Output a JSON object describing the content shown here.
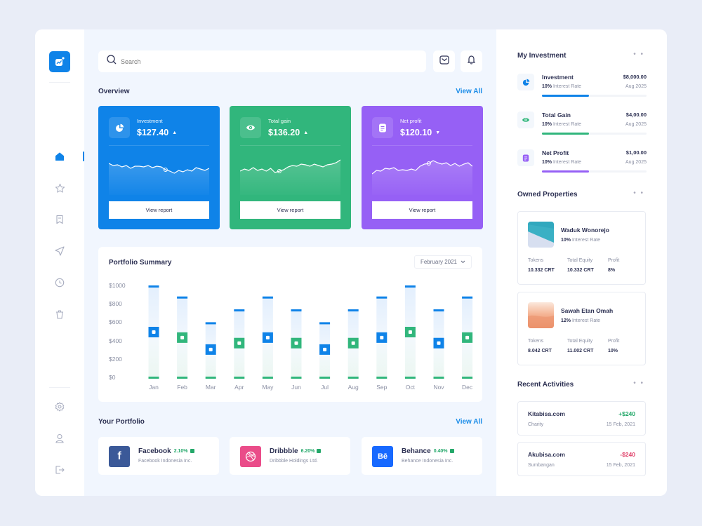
{
  "colors": {
    "brand": "#0f83e8",
    "green": "#31b67c",
    "purple": "#9660f5",
    "positive": "#24a86a",
    "negative": "#e0436b"
  },
  "sidebar": {
    "logo_icon": "chart-logo-icon",
    "nav": [
      {
        "icon": "home-icon",
        "active": true
      },
      {
        "icon": "star-icon",
        "active": false
      },
      {
        "icon": "bookmark-icon",
        "active": false
      },
      {
        "icon": "send-icon",
        "active": false
      },
      {
        "icon": "clock-icon",
        "active": false
      },
      {
        "icon": "trash-icon",
        "active": false
      }
    ],
    "bottom": [
      {
        "icon": "settings-icon"
      },
      {
        "icon": "user-icon"
      },
      {
        "icon": "logout-icon"
      }
    ]
  },
  "header": {
    "search_placeholder": "Search",
    "mail_icon": "mail-icon",
    "bell_icon": "bell-icon"
  },
  "overview": {
    "title": "Overview",
    "view_all": "View All",
    "cards": [
      {
        "label": "Investment",
        "value": "$127.40",
        "trend": "up",
        "trend_glyph": "▲",
        "button": "View report",
        "icon": "pie-chart-icon",
        "spark": [
          20,
          23,
          22,
          25,
          23,
          27,
          24,
          24,
          25,
          23,
          26,
          24,
          25,
          29,
          31,
          34,
          30,
          32,
          29,
          31,
          26,
          28,
          30,
          27
        ]
      },
      {
        "label": "Total gain",
        "value": "$136.20",
        "trend": "up",
        "trend_glyph": "▲",
        "button": "View report",
        "icon": "eye-icon",
        "spark": [
          31,
          28,
          30,
          26,
          30,
          28,
          31,
          27,
          33,
          31,
          29,
          25,
          23,
          24,
          21,
          22,
          24,
          21,
          23,
          25,
          22,
          21,
          19,
          15
        ]
      },
      {
        "label": "Net profit",
        "value": "$120.10",
        "trend": "down",
        "trend_glyph": "▼",
        "button": "View report",
        "icon": "document-icon",
        "spark": [
          35,
          30,
          31,
          27,
          28,
          26,
          30,
          29,
          30,
          28,
          30,
          24,
          21,
          20,
          16,
          19,
          21,
          19,
          23,
          20,
          24,
          21,
          19,
          24
        ]
      }
    ]
  },
  "portfolio_summary": {
    "title": "Portfolio Summary",
    "period": "February 2021",
    "chart_data": {
      "type": "bar",
      "title": "Portfolio Summary",
      "categories": [
        "Jan",
        "Feb",
        "Mar",
        "Apr",
        "May",
        "Jun",
        "Jul",
        "Aug",
        "Sep",
        "Oct",
        "Nov",
        "Dec"
      ],
      "series": [
        {
          "name": "High",
          "values": [
            1000,
            880,
            600,
            740,
            880,
            740,
            600,
            740,
            880,
            1000,
            740,
            880
          ]
        },
        {
          "name": "Marker",
          "values": [
            500,
            440,
            310,
            380,
            440,
            380,
            310,
            380,
            440,
            500,
            380,
            440
          ]
        }
      ],
      "marker_colors": [
        "blue",
        "green",
        "blue",
        "green",
        "blue",
        "green",
        "blue",
        "green",
        "blue",
        "green",
        "blue",
        "green"
      ],
      "yticks": [
        "$0",
        "$200",
        "$400",
        "$600",
        "$800",
        "$1000"
      ],
      "ylim": [
        0,
        1000
      ],
      "grid": false
    }
  },
  "your_portfolio": {
    "title": "Your Portfolio",
    "view_all": "View All",
    "items": [
      {
        "name": "Facebook",
        "pct": "2.10%",
        "company": "Facebook Indonesia Inc.",
        "logo": "f",
        "icon": "facebook-icon",
        "color": "#3b5998"
      },
      {
        "name": "Dribbble",
        "pct": "6.20%",
        "company": "Dribbble Holdings Ltd.",
        "logo": "",
        "icon": "dribbble-icon",
        "color": "#ea4c89"
      },
      {
        "name": "Behance",
        "pct": "0.40%",
        "company": "Behance Indonesia Inc.",
        "logo": "Bē",
        "icon": "behance-icon",
        "color": "#1769ff"
      }
    ]
  },
  "my_investment": {
    "title": "My Investment",
    "more": "• •",
    "items": [
      {
        "name": "Investment",
        "rate": "10%",
        "rate_label": "Interest Rate",
        "amount": "$8,000.00",
        "date": "Aug 2025",
        "progress": 0.45,
        "color": "#0f83e8",
        "icon": "pie-chart-icon"
      },
      {
        "name": "Total Gain",
        "rate": "10%",
        "rate_label": "Interest Rate",
        "amount": "$4,00.00",
        "date": "Aug 2025",
        "progress": 0.45,
        "color": "#31b67c",
        "icon": "eye-icon"
      },
      {
        "name": "Net Profit",
        "rate": "10%",
        "rate_label": "Interest Rate",
        "amount": "$1,00.00",
        "date": "Aug 2025",
        "progress": 0.45,
        "color": "#9660f5",
        "icon": "document-icon"
      }
    ]
  },
  "owned_properties": {
    "title": "Owned Properties",
    "more": "• •",
    "items": [
      {
        "name": "Waduk Wonorejo",
        "rate": "10%",
        "rate_label": "Interest Rate",
        "tokens_label": "Tokens",
        "tokens": "10.332 CRT",
        "equity_label": "Total Equity",
        "equity": "10.332 CRT",
        "profit_label": "Profit",
        "profit": "8%"
      },
      {
        "name": "Sawah Etan Omah",
        "rate": "12%",
        "rate_label": "Interest Rate",
        "tokens_label": "Tokens",
        "tokens": "8.042 CRT",
        "equity_label": "Total Equity",
        "equity": "11.002 CRT",
        "profit_label": "Profit",
        "profit": "10%"
      }
    ]
  },
  "recent_activities": {
    "title": "Recent Activities",
    "more": "• •",
    "items": [
      {
        "name": "Kitabisa.com",
        "category": "Charity",
        "amount": "+$240",
        "date": "15 Feb, 2021",
        "type": "positive"
      },
      {
        "name": "Akubisa.com",
        "category": "Sumbangan",
        "amount": "-$240",
        "date": "15 Feb, 2021",
        "type": "negative"
      }
    ]
  }
}
